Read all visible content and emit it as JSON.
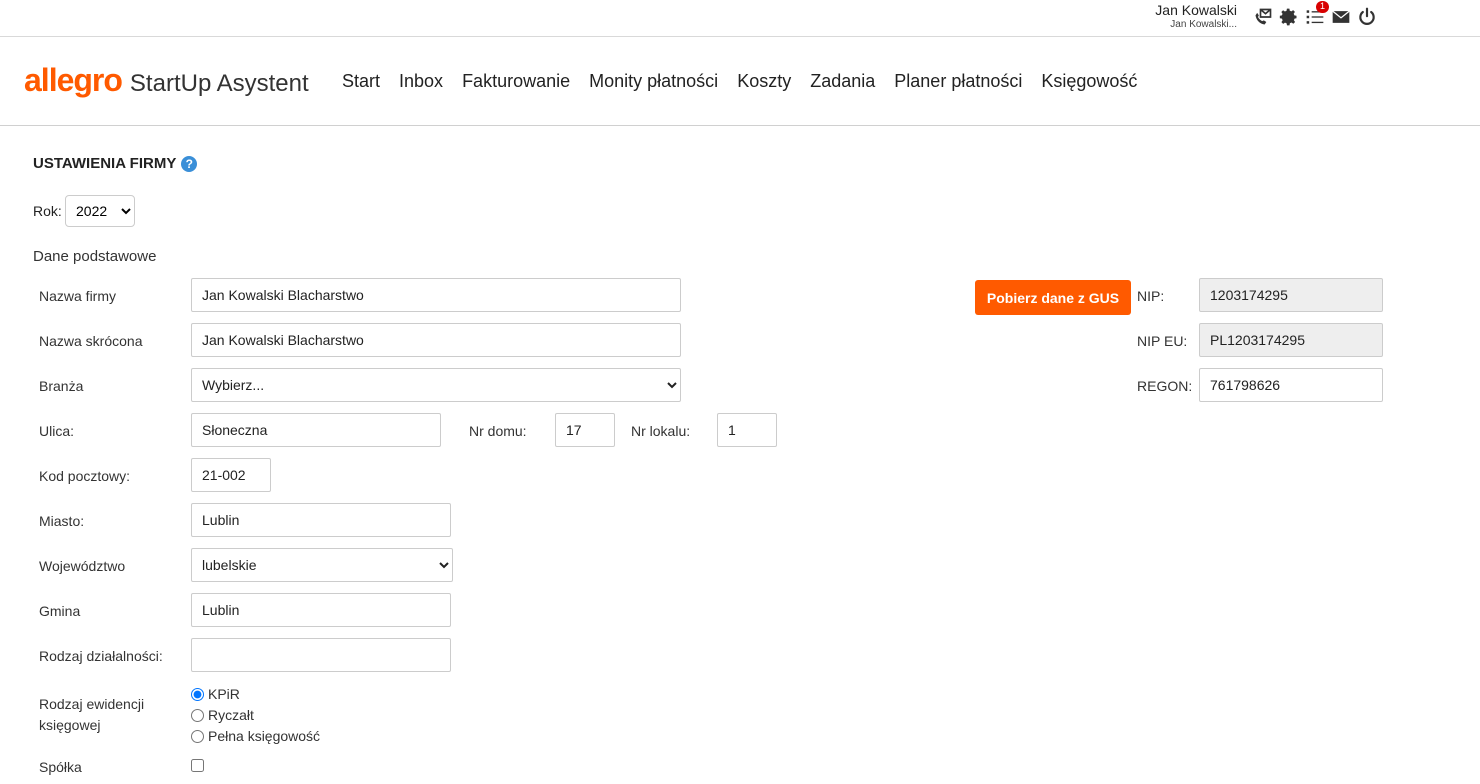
{
  "user": {
    "name": "Jan Kowalski",
    "sub": "Jan Kowalski..."
  },
  "top_icons": [
    {
      "name": "phone-mail-icon"
    },
    {
      "name": "gear-icon"
    },
    {
      "name": "task-list-icon",
      "badge": "1"
    },
    {
      "name": "envelope-icon"
    },
    {
      "name": "power-icon"
    }
  ],
  "brand": {
    "logo": "allegro",
    "app_name": "StartUp Asystent",
    "accent": "#ff5a00"
  },
  "nav": [
    "Start",
    "Inbox",
    "Fakturowanie",
    "Monity płatności",
    "Koszty",
    "Zadania",
    "Planer płatności",
    "Księgowość"
  ],
  "page": {
    "title": "USTAWIENIA FIRMY",
    "help": "?"
  },
  "year": {
    "label": "Rok:",
    "value": "2022"
  },
  "section": {
    "title": "Dane podstawowe"
  },
  "form": {
    "company_name": {
      "label": "Nazwa firmy",
      "value": "Jan Kowalski Blacharstwo"
    },
    "short_name": {
      "label": "Nazwa skrócona",
      "value": "Jan Kowalski Blacharstwo"
    },
    "industry": {
      "label": "Branża",
      "value": "Wybierz..."
    },
    "street": {
      "label": "Ulica:",
      "value": "Słoneczna"
    },
    "house_no": {
      "label": "Nr domu:",
      "value": "17"
    },
    "flat_no": {
      "label": "Nr lokalu:",
      "value": "1"
    },
    "postal_code": {
      "label": "Kod pocztowy:",
      "value": "21-002"
    },
    "city": {
      "label": "Miasto:",
      "value": "Lublin"
    },
    "voivodeship": {
      "label": "Województwo",
      "value": "lubelskie"
    },
    "commune": {
      "label": "Gmina",
      "value": "Lublin"
    },
    "activity_type": {
      "label": "Rodzaj działalności:",
      "value": ""
    },
    "accounting": {
      "label_line1": "Rodzaj ewidencji",
      "label_line2": "księgowej",
      "options": [
        "KPiR",
        "Ryczałt",
        "Pełna księgowość"
      ],
      "selected": "KPiR"
    },
    "partnership": {
      "label": "Spółka",
      "checked": false
    }
  },
  "gus_button": "Pobierz dane z GUS",
  "tax": {
    "nip": {
      "label": "NIP:",
      "value": "1203174295"
    },
    "nip_eu": {
      "label": "NIP EU:",
      "value": "PL1203174295"
    },
    "regon": {
      "label": "REGON:",
      "value": "761798626"
    }
  }
}
